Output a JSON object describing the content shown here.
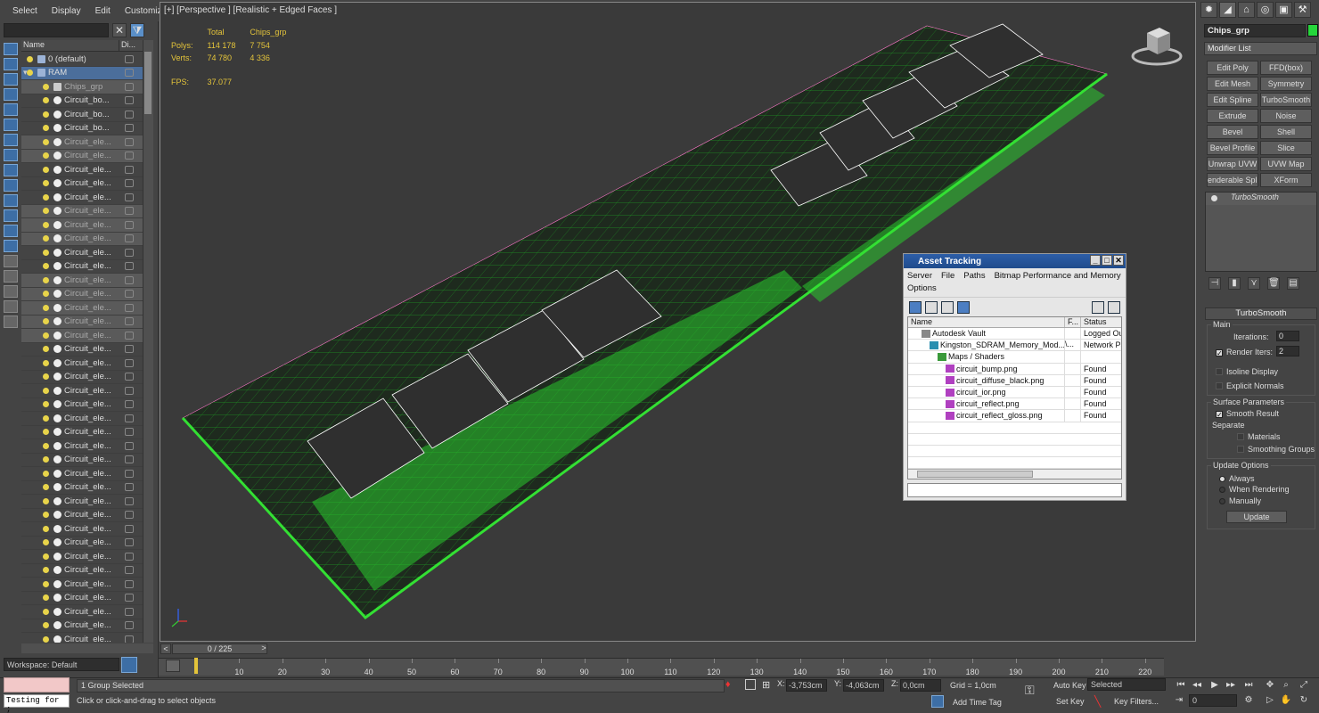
{
  "menu": [
    "Select",
    "Display",
    "Edit",
    "Customize"
  ],
  "explorer": {
    "col_name": "Name",
    "col_display": "Di...",
    "rows": [
      {
        "label": "0 (default)",
        "type": "layer",
        "indent": 0
      },
      {
        "label": "RAM",
        "type": "layer",
        "indent": 0,
        "selected": true
      },
      {
        "label": "Chips_grp",
        "type": "group",
        "indent": 1,
        "dim": true
      },
      {
        "label": "Circuit_bo...",
        "type": "object",
        "indent": 1
      },
      {
        "label": "Circuit_bo...",
        "type": "object",
        "indent": 1
      },
      {
        "label": "Circuit_bo...",
        "type": "object",
        "indent": 1
      },
      {
        "label": "Circuit_ele...",
        "type": "object",
        "indent": 1,
        "dim": true
      },
      {
        "label": "Circuit_ele...",
        "type": "object",
        "indent": 1,
        "dim": true
      },
      {
        "label": "Circuit_ele...",
        "type": "object",
        "indent": 1
      },
      {
        "label": "Circuit_ele...",
        "type": "object",
        "indent": 1
      },
      {
        "label": "Circuit_ele...",
        "type": "object",
        "indent": 1
      },
      {
        "label": "Circuit_ele...",
        "type": "object",
        "indent": 1,
        "dim": true
      },
      {
        "label": "Circuit_ele...",
        "type": "object",
        "indent": 1,
        "dim": true
      },
      {
        "label": "Circuit_ele...",
        "type": "object",
        "indent": 1,
        "dim": true
      },
      {
        "label": "Circuit_ele...",
        "type": "object",
        "indent": 1
      },
      {
        "label": "Circuit_ele...",
        "type": "object",
        "indent": 1
      },
      {
        "label": "Circuit_ele...",
        "type": "object",
        "indent": 1,
        "dim": true
      },
      {
        "label": "Circuit_ele...",
        "type": "object",
        "indent": 1,
        "dim": true
      },
      {
        "label": "Circuit_ele...",
        "type": "object",
        "indent": 1,
        "dim": true
      },
      {
        "label": "Circuit_ele...",
        "type": "object",
        "indent": 1,
        "dim": true
      },
      {
        "label": "Circuit_ele...",
        "type": "object",
        "indent": 1,
        "dim": true
      },
      {
        "label": "Circuit_ele...",
        "type": "object",
        "indent": 1
      },
      {
        "label": "Circuit_ele...",
        "type": "object",
        "indent": 1
      },
      {
        "label": "Circuit_ele...",
        "type": "object",
        "indent": 1
      },
      {
        "label": "Circuit_ele...",
        "type": "object",
        "indent": 1
      },
      {
        "label": "Circuit_ele...",
        "type": "object",
        "indent": 1
      },
      {
        "label": "Circuit_ele...",
        "type": "object",
        "indent": 1
      },
      {
        "label": "Circuit_ele...",
        "type": "object",
        "indent": 1
      },
      {
        "label": "Circuit_ele...",
        "type": "object",
        "indent": 1
      },
      {
        "label": "Circuit_ele...",
        "type": "object",
        "indent": 1
      },
      {
        "label": "Circuit_ele...",
        "type": "object",
        "indent": 1
      },
      {
        "label": "Circuit_ele...",
        "type": "object",
        "indent": 1
      },
      {
        "label": "Circuit_ele...",
        "type": "object",
        "indent": 1
      },
      {
        "label": "Circuit_ele...",
        "type": "object",
        "indent": 1
      },
      {
        "label": "Circuit_ele...",
        "type": "object",
        "indent": 1
      },
      {
        "label": "Circuit_ele...",
        "type": "object",
        "indent": 1
      },
      {
        "label": "Circuit_ele...",
        "type": "object",
        "indent": 1
      },
      {
        "label": "Circuit_ele...",
        "type": "object",
        "indent": 1
      },
      {
        "label": "Circuit_ele...",
        "type": "object",
        "indent": 1
      },
      {
        "label": "Circuit_ele...",
        "type": "object",
        "indent": 1
      },
      {
        "label": "Circuit_ele...",
        "type": "object",
        "indent": 1
      },
      {
        "label": "Circuit_ele...",
        "type": "object",
        "indent": 1
      },
      {
        "label": "Circuit_ele...",
        "type": "object",
        "indent": 1
      }
    ]
  },
  "workspace": "Workspace: Default",
  "viewport": {
    "label": "[+] [Perspective ] [Realistic + Edged Faces ]",
    "stats": {
      "h_total": "Total",
      "h_sel": "Chips_grp",
      "polys_label": "Polys:",
      "polys_total": "114 178",
      "polys_sel": "7 754",
      "verts_label": "Verts:",
      "verts_total": "74 780",
      "verts_sel": "4 336",
      "fps_label": "FPS:",
      "fps": "37.077"
    },
    "accent_green": "#22d62e"
  },
  "asset": {
    "title": "Asset Tracking",
    "menu": [
      "Server",
      "File",
      "Paths",
      "Bitmap Performance and Memory",
      "Options"
    ],
    "col_name": "Name",
    "col_f": "F...",
    "col_status": "Status",
    "rows": [
      {
        "name": "Autodesk Vault",
        "f": "",
        "status": "Logged Out",
        "indent": 1,
        "icon": "vault-icon"
      },
      {
        "name": "Kingston_SDRAM_Memory_Mod...",
        "f": "\\...",
        "status": "Network Pa",
        "indent": 2,
        "icon": "max-file-icon"
      },
      {
        "name": "Maps / Shaders",
        "f": "",
        "status": "",
        "indent": 3,
        "icon": "maps-icon"
      },
      {
        "name": "circuit_bump.png",
        "f": "",
        "status": "Found",
        "indent": 4,
        "icon": "png-icon"
      },
      {
        "name": "circuit_diffuse_black.png",
        "f": "",
        "status": "Found",
        "indent": 4,
        "icon": "png-icon"
      },
      {
        "name": "circuit_ior.png",
        "f": "",
        "status": "Found",
        "indent": 4,
        "icon": "png-icon"
      },
      {
        "name": "circuit_reflect.png",
        "f": "",
        "status": "Found",
        "indent": 4,
        "icon": "png-icon"
      },
      {
        "name": "circuit_reflect_gloss.png",
        "f": "",
        "status": "Found",
        "indent": 4,
        "icon": "png-icon"
      }
    ]
  },
  "command": {
    "object_name": "Chips_grp",
    "object_color": "#26d63b",
    "modifier_list": "Modifier List",
    "modifiers": [
      "Edit Poly",
      "FFD(box)",
      "Edit Mesh",
      "Symmetry",
      "Edit Spline",
      "TurboSmooth",
      "Extrude",
      "Noise",
      "Bevel",
      "Shell",
      "Bevel Profile",
      "Slice",
      "Unwrap UVW",
      "UVW Map",
      "enderable Splin",
      "XForm"
    ],
    "stack_item": "TurboSmooth",
    "rollout_title": "TurboSmooth",
    "main_label": "Main",
    "iterations_label": "Iterations:",
    "iterations_value": "0",
    "render_iters_label": "Render Iters:",
    "render_iters_value": "2",
    "isoline": "Isoline Display",
    "explicit": "Explicit Normals",
    "surface_label": "Surface Parameters",
    "smooth_result": "Smooth Result",
    "separate_label": "Separate",
    "materials": "Materials",
    "smoothing_groups": "Smoothing Groups",
    "update_label": "Update Options",
    "always": "Always",
    "when_rendering": "When Rendering",
    "manually": "Manually",
    "update_btn": "Update"
  },
  "timeline": {
    "slider": "0 / 225",
    "ticks": [
      "10",
      "20",
      "30",
      "40",
      "50",
      "60",
      "70",
      "80",
      "90",
      "100",
      "110",
      "120",
      "130",
      "140",
      "150",
      "160",
      "170",
      "180",
      "190",
      "200",
      "210",
      "220"
    ]
  },
  "status": {
    "maxscript": "Testing for ;",
    "selection": "1 Group Selected",
    "prompt": "Click or click-and-drag to select objects",
    "x_label": "X:",
    "x_value": "-3,753cm",
    "y_label": "Y:",
    "y_value": "-4,063cm",
    "z_label": "Z:",
    "z_value": "0,0cm",
    "grid": "Grid = 1,0cm",
    "add_time_tag": "Add Time Tag",
    "auto_key": "Auto Key",
    "set_key": "Set Key",
    "selected_dropdown": "Selected",
    "key_filters": "Key Filters...",
    "frame": "0"
  }
}
